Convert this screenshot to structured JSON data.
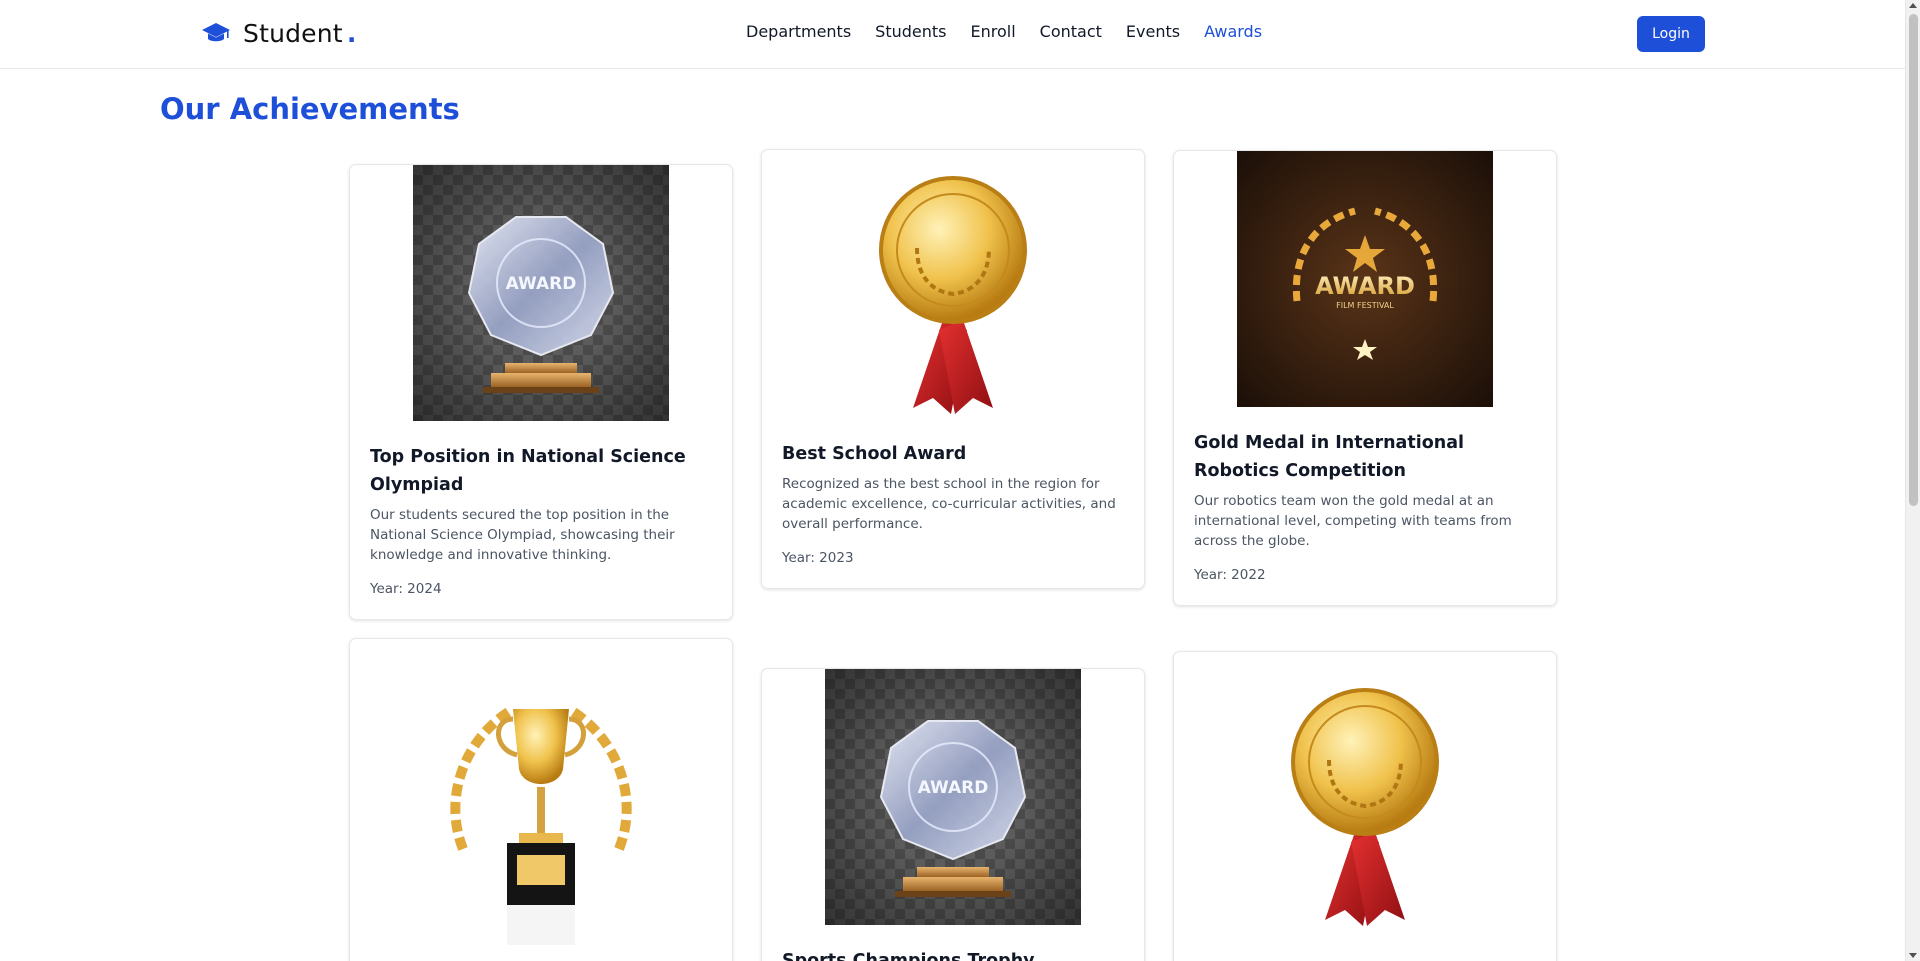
{
  "brand": {
    "name": "Student",
    "dot": "."
  },
  "nav": {
    "items": [
      "Departments",
      "Students",
      "Enroll",
      "Contact",
      "Events",
      "Awards"
    ],
    "active": "Awards"
  },
  "login_label": "Login",
  "page_title": "Our Achievements",
  "colors": {
    "accent": "#1e4fd8",
    "gold": "#e2b23a",
    "ribbon": "#c81e1e"
  },
  "cards": [
    {
      "image": "crystal-award-trophy",
      "title": "Top Position in National Science Olympiad",
      "desc": "Our students secured the top position in the National Science Olympiad, showcasing their knowledge and innovative thinking.",
      "year": "Year: 2024"
    },
    {
      "image": "gold-medal-ribbon",
      "title": "Best School Award",
      "desc": "Recognized as the best school in the region for academic excellence, co-curricular activities, and overall performance.",
      "year": "Year: 2023"
    },
    {
      "image": "golden-laurel-award-badge",
      "image_text": "AWARD",
      "image_subtext": "FILM FESTIVAL",
      "title": "Gold Medal in International Robotics Competition",
      "desc": "Our robotics team won the gold medal at an international level, competing with teams from across the globe.",
      "year": "Year: 2022"
    },
    {
      "image": "gold-cup-trophy-laurel"
    },
    {
      "image": "crystal-award-trophy",
      "title": "Sports Champions Trophy"
    },
    {
      "image": "gold-medal-ribbon"
    }
  ],
  "crystal_text": "AWARD"
}
